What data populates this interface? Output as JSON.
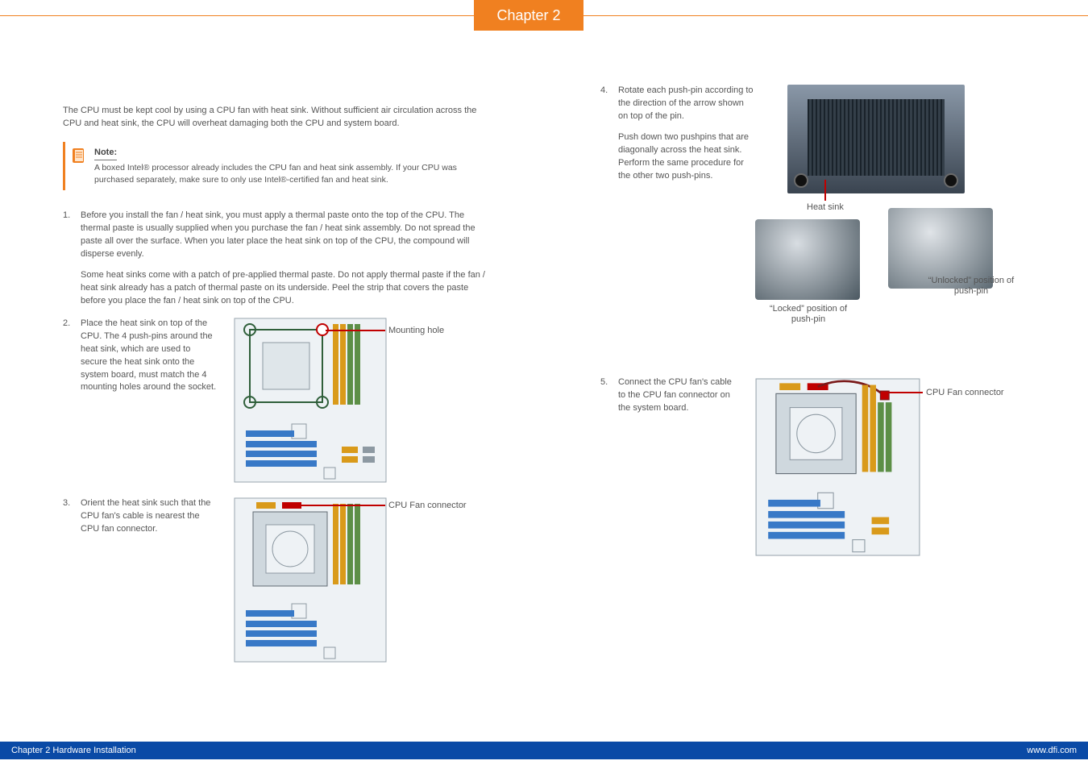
{
  "header": {
    "chapter_tab": "Chapter 2"
  },
  "footer": {
    "left": "Chapter 2 Hardware Installation",
    "right": "www.dfi.com"
  },
  "left": {
    "intro": "The CPU must be kept cool by using a CPU fan with heat sink. Without sufficient air circulation across the CPU and heat sink, the CPU will overheat damaging both the CPU and system board.",
    "note_label": "Note:",
    "note_text": "A boxed Intel® processor already includes the CPU fan and heat sink assembly. If your CPU was purchased separately, make sure to only use Intel®-certified fan and heat sink.",
    "steps": [
      {
        "num": "1.",
        "text": "Before you install the fan / heat sink, you must apply a thermal paste onto the top of the CPU. The thermal paste is usually supplied when you purchase the fan / heat sink assembly. Do not spread the paste all over the surface. When you later place the heat sink on top of the CPU, the compound will disperse evenly.",
        "text2": "Some heat sinks come with a patch of pre-applied thermal paste. Do not apply thermal paste if the fan / heat sink already has a patch of thermal paste on its underside. Peel the strip that covers the paste before you place the fan / heat sink on top of the CPU."
      },
      {
        "num": "2.",
        "text": "Place the heat sink on top of the CPU. The 4 push-pins around the heat sink, which are used to secure the heat sink onto the system board, must match the 4 mounting holes around the socket.",
        "callout": "Mounting hole"
      },
      {
        "num": "3.",
        "text": "Orient the heat sink such that the CPU fan's cable is nearest the CPU fan connector.",
        "callout": "CPU Fan connector"
      }
    ]
  },
  "right": {
    "steps": [
      {
        "num": "4.",
        "text": "Rotate each push-pin according to the direction of the arrow shown on top of the pin.",
        "text2": "Push down two pushpins that are diagonally across the heat sink. Perform the same procedure for the other two push-pins.",
        "labels": {
          "heat_sink": "Heat sink",
          "locked": "“Locked” position of push-pin",
          "unlocked": "“Unlocked” position of push-pin"
        }
      },
      {
        "num": "5.",
        "text": "Connect the CPU fan's cable to the CPU fan connector on the system board.",
        "callout": "CPU Fan connector"
      }
    ]
  }
}
